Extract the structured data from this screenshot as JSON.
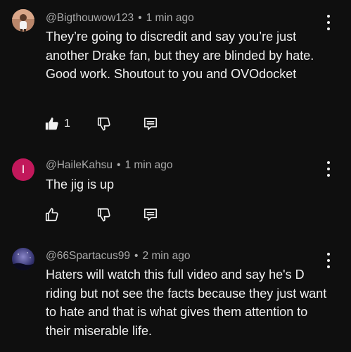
{
  "comments": [
    {
      "handle": "@Bigthouwow123",
      "time": "1 min ago",
      "text": "They’re going to discredit and say you’re just another Drake fan, but they are blinded by hate. Good work. Shoutout to you and OVOdocket",
      "likes": "1",
      "avatar_icon": "photo-avatar",
      "liked": true
    },
    {
      "handle": "@HaileKahsu",
      "time": "1 min ago",
      "text": "The jig is up",
      "likes": "",
      "avatar_letter": "I",
      "avatar_color": "#c2185b",
      "liked": false
    },
    {
      "handle": "@66Spartacus99",
      "time": "2 min ago",
      "text": "Haters will watch this full video and say he's D riding but not see the facts because they just want to hate and that is what gives them attention to their miserable life.",
      "likes": "",
      "avatar_icon": "night-sky-avatar",
      "liked": false
    }
  ],
  "separator": "•",
  "icons": {
    "like": "thumbs-up-icon",
    "dislike": "thumbs-down-icon",
    "reply": "reply-icon",
    "menu": "more-vertical-icon"
  }
}
